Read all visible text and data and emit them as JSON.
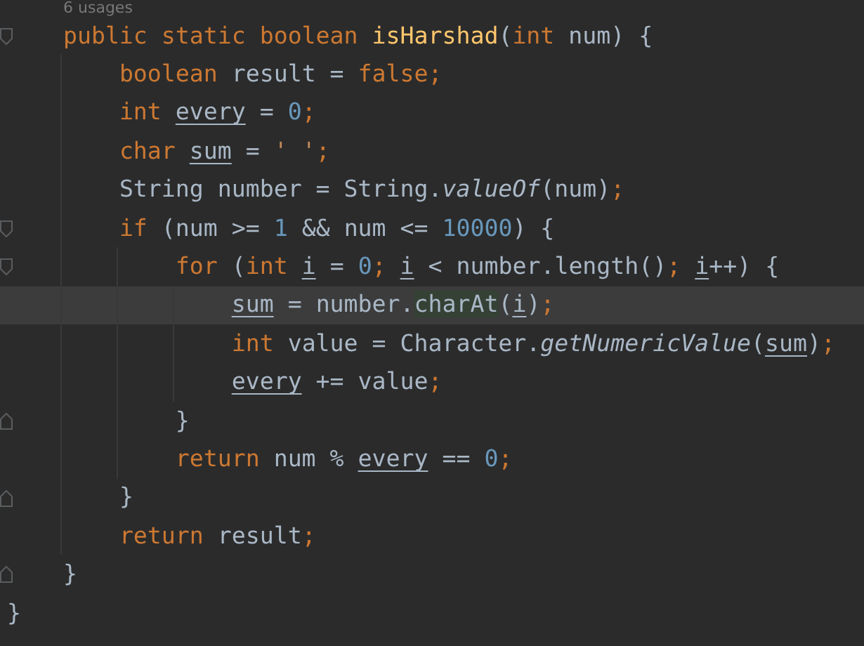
{
  "editor": {
    "usages_hint": "6 usages",
    "lines": [
      {
        "fold_start": true,
        "fold_end": false,
        "caret_line": false,
        "tokens": [
          {
            "kind": "keyword",
            "text": "    public static boolean "
          },
          {
            "kind": "declaration",
            "text": "isHarshad"
          },
          {
            "kind": "plain",
            "text": "("
          },
          {
            "kind": "keyword",
            "text": "int "
          },
          {
            "kind": "plain",
            "text": "num) {"
          }
        ]
      },
      {
        "fold_start": false,
        "fold_end": false,
        "caret_line": false,
        "tokens": [
          {
            "kind": "keyword",
            "text": "        boolean "
          },
          {
            "kind": "plain",
            "text": "result = "
          },
          {
            "kind": "keyword",
            "text": "false;"
          }
        ]
      },
      {
        "fold_start": false,
        "fold_end": false,
        "caret_line": false,
        "tokens": [
          {
            "kind": "keyword",
            "text": "        int "
          },
          {
            "kind": "variable",
            "text": "every"
          },
          {
            "kind": "plain",
            "text": " = "
          },
          {
            "kind": "number",
            "text": "0"
          },
          {
            "kind": "keyword",
            "text": ";"
          }
        ]
      },
      {
        "fold_start": false,
        "fold_end": false,
        "caret_line": false,
        "tokens": [
          {
            "kind": "keyword",
            "text": "        char "
          },
          {
            "kind": "variable",
            "text": "sum"
          },
          {
            "kind": "plain",
            "text": " = "
          },
          {
            "kind": "string",
            "text": "' '"
          },
          {
            "kind": "keyword",
            "text": ";"
          }
        ]
      },
      {
        "fold_start": false,
        "fold_end": false,
        "caret_line": false,
        "tokens": [
          {
            "kind": "plain",
            "text": "        String number = String."
          },
          {
            "kind": "static",
            "text": "valueOf"
          },
          {
            "kind": "plain",
            "text": "(num)"
          },
          {
            "kind": "keyword",
            "text": ";"
          }
        ]
      },
      {
        "fold_start": true,
        "fold_end": false,
        "caret_line": false,
        "tokens": [
          {
            "kind": "keyword",
            "text": "        if "
          },
          {
            "kind": "plain",
            "text": "(num >= "
          },
          {
            "kind": "number",
            "text": "1 "
          },
          {
            "kind": "plain",
            "text": "&& num <= "
          },
          {
            "kind": "number",
            "text": "10000"
          },
          {
            "kind": "plain",
            "text": ") {"
          }
        ]
      },
      {
        "fold_start": true,
        "fold_end": false,
        "caret_line": false,
        "tokens": [
          {
            "kind": "keyword",
            "text": "            for "
          },
          {
            "kind": "plain",
            "text": "("
          },
          {
            "kind": "keyword",
            "text": "int "
          },
          {
            "kind": "variable",
            "text": "i"
          },
          {
            "kind": "plain",
            "text": " = "
          },
          {
            "kind": "number",
            "text": "0"
          },
          {
            "kind": "keyword",
            "text": "; "
          },
          {
            "kind": "variable",
            "text": "i"
          },
          {
            "kind": "plain",
            "text": " < number.length()"
          },
          {
            "kind": "keyword",
            "text": "; "
          },
          {
            "kind": "variable",
            "text": "i"
          },
          {
            "kind": "plain",
            "text": "++) {"
          }
        ]
      },
      {
        "fold_start": false,
        "fold_end": false,
        "caret_line": true,
        "tokens": [
          {
            "kind": "variable",
            "text": "                sum"
          },
          {
            "kind": "plain",
            "text": " = number."
          },
          {
            "kind": "match",
            "text": "charAt"
          },
          {
            "kind": "plain",
            "text": "("
          },
          {
            "kind": "variable",
            "text": "i"
          },
          {
            "kind": "plain",
            "text": ")"
          },
          {
            "kind": "keyword",
            "text": ";"
          }
        ]
      },
      {
        "fold_start": false,
        "fold_end": false,
        "caret_line": false,
        "tokens": [
          {
            "kind": "keyword",
            "text": "                int "
          },
          {
            "kind": "plain",
            "text": "value = Character."
          },
          {
            "kind": "static",
            "text": "getNumericValue"
          },
          {
            "kind": "plain",
            "text": "("
          },
          {
            "kind": "variable",
            "text": "sum"
          },
          {
            "kind": "plain",
            "text": ")"
          },
          {
            "kind": "keyword",
            "text": ";"
          }
        ]
      },
      {
        "fold_start": false,
        "fold_end": false,
        "caret_line": false,
        "tokens": [
          {
            "kind": "variable",
            "text": "                every"
          },
          {
            "kind": "plain",
            "text": " += value"
          },
          {
            "kind": "keyword",
            "text": ";"
          }
        ]
      },
      {
        "fold_start": false,
        "fold_end": true,
        "caret_line": false,
        "tokens": [
          {
            "kind": "plain",
            "text": "            }"
          }
        ]
      },
      {
        "fold_start": false,
        "fold_end": false,
        "caret_line": false,
        "tokens": [
          {
            "kind": "keyword",
            "text": "            return "
          },
          {
            "kind": "plain",
            "text": "num % "
          },
          {
            "kind": "variable",
            "text": "every"
          },
          {
            "kind": "plain",
            "text": " == "
          },
          {
            "kind": "number",
            "text": "0"
          },
          {
            "kind": "keyword",
            "text": ";"
          }
        ]
      },
      {
        "fold_start": false,
        "fold_end": true,
        "caret_line": false,
        "tokens": [
          {
            "kind": "plain",
            "text": "        }"
          }
        ]
      },
      {
        "fold_start": false,
        "fold_end": false,
        "caret_line": false,
        "tokens": [
          {
            "kind": "keyword",
            "text": "        return "
          },
          {
            "kind": "plain",
            "text": "result"
          },
          {
            "kind": "keyword",
            "text": ";"
          }
        ]
      },
      {
        "fold_start": false,
        "fold_end": true,
        "caret_line": false,
        "tokens": [
          {
            "kind": "plain",
            "text": "    }"
          }
        ]
      },
      {
        "fold_start": false,
        "fold_end": false,
        "caret_line": false,
        "tokens": [
          {
            "kind": "plain",
            "text": "}"
          }
        ]
      }
    ]
  }
}
